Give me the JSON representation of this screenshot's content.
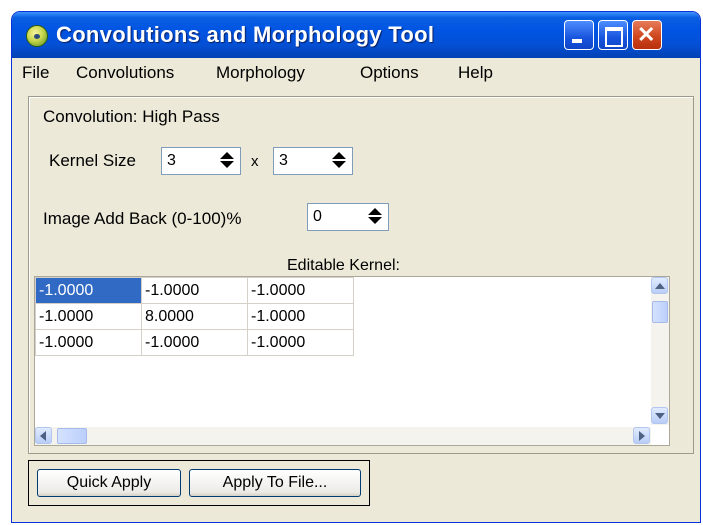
{
  "window": {
    "title": "Convolutions and Morphology Tool"
  },
  "titlebar_buttons": {
    "minimize": "minimize-icon",
    "maximize": "maximize-icon",
    "close": "close-icon"
  },
  "menu": [
    "File",
    "Convolutions",
    "Morphology",
    "Options",
    "Help"
  ],
  "panel": {
    "convolution_label": "Convolution: High Pass",
    "kernel_size_label": "Kernel Size",
    "kernel_rows": "3",
    "times": "x",
    "kernel_cols": "3",
    "add_back_label": "Image Add Back (0-100)%",
    "add_back_value": "0",
    "editable_kernel_label": "Editable Kernel:",
    "kernel": [
      [
        "-1.0000",
        "-1.0000",
        "-1.0000"
      ],
      [
        "-1.0000",
        "8.0000",
        "-1.0000"
      ],
      [
        "-1.0000",
        "-1.0000",
        "-1.0000"
      ]
    ]
  },
  "buttons": {
    "quick_apply": "Quick Apply",
    "apply_to_file": "Apply To File..."
  },
  "colors": {
    "titlebar": "#0054e3",
    "selection": "#316ac5",
    "window_bg": "#ece9d8"
  }
}
